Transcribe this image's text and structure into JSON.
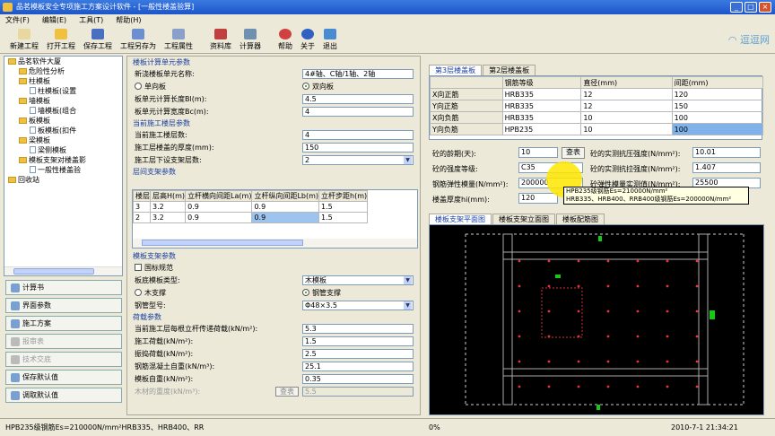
{
  "window": {
    "title": "品茗模板安全专项施工方案设计软件 - [一般性楼盖验算]"
  },
  "menu": [
    "文件(F)",
    "编辑(E)",
    "工具(T)",
    "帮助(H)"
  ],
  "toolbar": [
    "新建工程",
    "打开工程",
    "保存工程",
    "工程另存为",
    "工程属性",
    "资料库",
    "计算器",
    "帮助",
    "关于",
    "退出"
  ],
  "tree": [
    {
      "label": "品茗软件大厦",
      "depth": 0
    },
    {
      "label": "危险性分析",
      "depth": 1
    },
    {
      "label": "柱模板",
      "depth": 1
    },
    {
      "label": "柱模板(设置",
      "depth": 2
    },
    {
      "label": "墙模板",
      "depth": 1
    },
    {
      "label": "墙模板(组合",
      "depth": 2
    },
    {
      "label": "板模板",
      "depth": 1
    },
    {
      "label": "板模板(扣件",
      "depth": 2
    },
    {
      "label": "梁模板",
      "depth": 1
    },
    {
      "label": "梁侧模板",
      "depth": 2
    },
    {
      "label": "模板支架对楼盖影",
      "depth": 1
    },
    {
      "label": "一般性楼盖验",
      "depth": 2
    },
    {
      "label": "回收站",
      "depth": 0
    }
  ],
  "leftbuttons": [
    {
      "label": "计算书",
      "disabled": false
    },
    {
      "label": "界面参数",
      "disabled": false
    },
    {
      "label": "施工方案",
      "disabled": false
    },
    {
      "label": "报审表",
      "disabled": true
    },
    {
      "label": "技术交底",
      "disabled": true
    },
    {
      "label": "保存默认值",
      "disabled": false
    },
    {
      "label": "调取默认值",
      "disabled": false
    }
  ],
  "mid": {
    "s1": "楼板计算单元参数",
    "l_name": "新浇楼板单元名称:",
    "v_name": "4#轴、C轴/1轴、2轴",
    "r_one": "单向板",
    "r_two": "双向板",
    "l_len": "板单元计算长度Bl(m):",
    "v_len": "4.5",
    "l_wid": "板单元计算宽度Bc(m):",
    "v_wid": "4",
    "s2": "当前施工楼层参数",
    "l_floor": "当前施工楼层数:",
    "v_floor": "4",
    "l_thick": "施工层楼盖的厚度(mm):",
    "v_thick": "150",
    "l_layers": "施工层下设支架层数:",
    "v_layers": "2",
    "s3": "层间支架参数",
    "grid_head": [
      "楼层",
      "层高H(m)",
      "立杆横向间距La(m)",
      "立杆纵向间距Lb(m)",
      "立杆步距h(m)"
    ],
    "grid_rows": [
      [
        "3",
        "3.2",
        "0.9",
        "0.9",
        "1.5"
      ],
      [
        "2",
        "3.2",
        "0.9",
        "0.9",
        "1.5"
      ]
    ],
    "s4": "模板支架参数",
    "chk_std": "国标规范",
    "l_ptype": "板底模板类型:",
    "v_ptype": "木模板",
    "r_wood": "木支撑",
    "r_steel": "钢管支撑",
    "l_pipe": "钢管型号:",
    "v_pipe": "Φ48×3.5",
    "s5": "荷载参数",
    "l_q1": "当前施工层每根立杆传递荷载(kN/m²):",
    "v_q1": "5.3",
    "l_q2": "施工荷载(kN/m²):",
    "v_q2": "1.5",
    "l_q3": "振捣荷载(kN/m²):",
    "v_q3": "2.5",
    "l_q4": "钢筋混凝土自重(kN/m³):",
    "v_q4": "25.1",
    "l_q5": "模板自重(kN/m²):",
    "v_q5": "0.35",
    "l_q6": "木材的重度(kN/m³):",
    "v_q6": "5.5",
    "b_q6": "查表"
  },
  "right": {
    "tabs": [
      "第3层楼盖板",
      "第2层楼盖板"
    ],
    "rebar_head": [
      "",
      "钢筋等级",
      "直径(mm)",
      "间距(mm)"
    ],
    "rebar_rows": [
      [
        "X向正筋",
        "HRB335",
        "12",
        "120"
      ],
      [
        "Y向正筋",
        "HRB335",
        "12",
        "150"
      ],
      [
        "X向负筋",
        "HRB335",
        "10",
        "100"
      ],
      [
        "Y向负筋",
        "HPB235",
        "10",
        "100"
      ]
    ],
    "l_age": "砼的龄期(天):",
    "v_age": "10",
    "b_look": "查表",
    "l_fc": "砼的实测抗压强度(N/mm²):",
    "v_fc": "10.01",
    "l_grade": "砼的强度等级:",
    "v_grade": "C35",
    "l_ft": "砼的实测抗拉强度(N/mm²):",
    "v_ft": "1.407",
    "l_es": "钢筋弹性模量(N/mm²):",
    "v_es": "200000",
    "l_ec": "砼弹性模量实测值(N/mm²):",
    "v_ec": "25500",
    "l_h": "楼盖厚度hi(mm):",
    "v_h": "120",
    "tip1": "HPB235级钢筋Es=210000N/mm²",
    "tip2": "HRB335、HRB400、RRB400级钢筋Es=200000N/mm²",
    "dtabs": [
      "楼板支架平面图",
      "楼板支架立面图",
      "楼板配筋图"
    ]
  },
  "status": {
    "msg": "HPB235级钢筋Es=210000N/mm²HRB335、HRB400、RR",
    "pct": "0%",
    "time": "2010-7-1  21:34:21"
  }
}
